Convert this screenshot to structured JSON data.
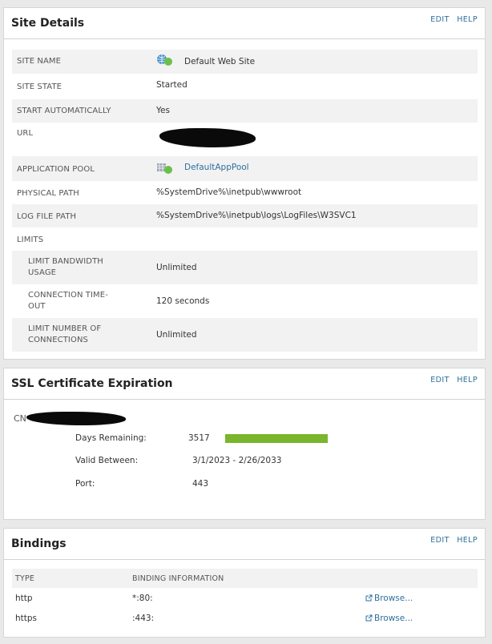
{
  "site_details": {
    "title": "Site Details",
    "edit_label": "EDIT",
    "help_label": "HELP",
    "rows": [
      {
        "label": "SITE NAME",
        "value": "Default Web Site"
      },
      {
        "label": "SITE STATE",
        "value": "Started"
      },
      {
        "label": "START AUTOMATICALLY",
        "value": "Yes"
      },
      {
        "label": "URL",
        "value": ""
      },
      {
        "label": "APPLICATION POOL",
        "value": "DefaultAppPool"
      },
      {
        "label": "PHYSICAL PATH",
        "value": "%SystemDrive%\\inetpub\\wwwroot"
      },
      {
        "label": "LOG FILE PATH",
        "value": "%SystemDrive%\\inetpub\\logs\\LogFiles\\W3SVC1"
      },
      {
        "label": "LIMITS",
        "value": ""
      },
      {
        "label": "LIMIT BANDWIDTH USAGE",
        "value": "Unlimited"
      },
      {
        "label": "CONNECTION TIME-OUT",
        "value": "120 seconds"
      },
      {
        "label": "LIMIT NUMBER OF CONNECTIONS",
        "value": "Unlimited"
      }
    ]
  },
  "ssl": {
    "title": "SSL Certificate Expiration",
    "edit_label": "EDIT",
    "help_label": "HELP",
    "cn_prefix": "CN",
    "days_label": "Days Remaining:",
    "days_value": "3517",
    "days_fill_fraction": 1.0,
    "valid_label": "Valid Between:",
    "valid_value": "3/1/2023 - 2/26/2033",
    "port_label": "Port:",
    "port_value": "443",
    "bar_color": "#7ab52e"
  },
  "bindings": {
    "title": "Bindings",
    "edit_label": "EDIT",
    "help_label": "HELP",
    "col_type": "TYPE",
    "col_info": "BINDING INFORMATION",
    "rows": [
      {
        "type": "http",
        "info": "*:80:",
        "browse": "Browse..."
      },
      {
        "type": "https",
        "info": ":443:",
        "browse": "Browse..."
      }
    ]
  },
  "colors": {
    "link": "#2e6f9e",
    "status_green": "#6cc04a"
  }
}
